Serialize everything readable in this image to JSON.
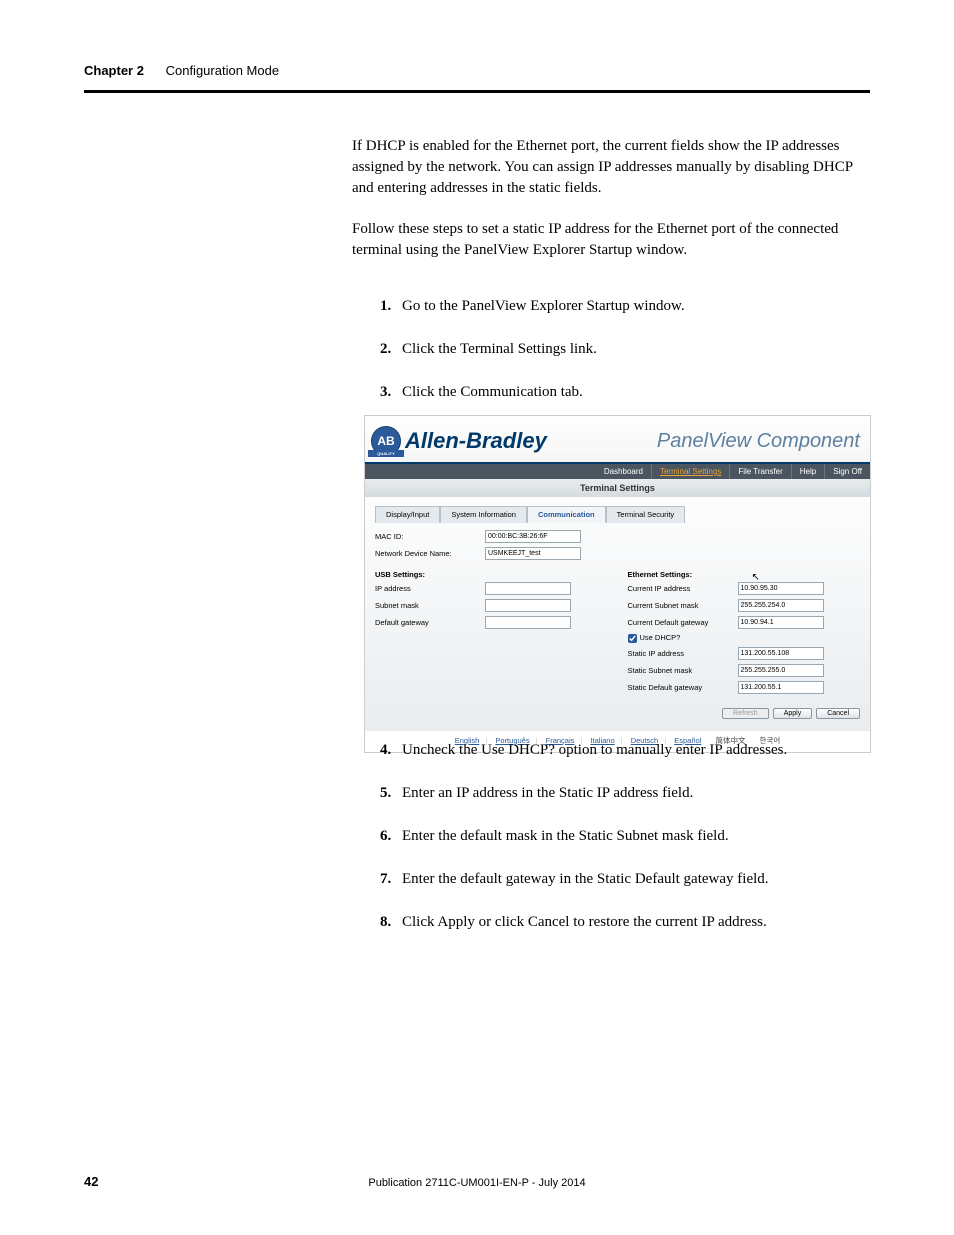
{
  "header": {
    "chapter": "Chapter 2",
    "title": "Configuration Mode"
  },
  "para1": "If DHCP is enabled for the Ethernet port, the current fields show the IP addresses assigned by the network. You can assign IP addresses manually by disabling DHCP and entering addresses in the static fields.",
  "para2": "Follow these steps to set a static IP address for the Ethernet port of the connected terminal using the PanelView Explorer Startup window.",
  "steps_a": [
    "Go to the PanelView Explorer Startup window.",
    "Click the Terminal Settings link.",
    "Click the Communication tab."
  ],
  "steps_b": [
    "Uncheck the Use DHCP? option to manually enter IP addresses.",
    "Enter an IP address in the Static IP address field.",
    "Enter the default mask in the Static Subnet mask field.",
    "Enter the default gateway in the Static Default gateway field.",
    "Click Apply or click Cancel to restore the current IP address."
  ],
  "ui": {
    "brand": "Allen-Bradley",
    "logo_text": "AB",
    "product": "PanelView Component",
    "top_tabs": [
      "Dashboard",
      "Terminal Settings",
      "File Transfer",
      "Help",
      "Sign Off"
    ],
    "section_title": "Terminal Settings",
    "sub_tabs": [
      "Display/Input",
      "System Information",
      "Communication",
      "Terminal Security"
    ],
    "mac_label": "MAC ID:",
    "mac_value": "00:00:BC:3B:26:6F",
    "dev_label": "Network Device Name:",
    "dev_value": "USMKEEJT_test",
    "usb_head": "USB Settings:",
    "usb_ip_label": "IP address",
    "usb_ip_value": "",
    "usb_mask_label": "Subnet mask",
    "usb_mask_value": "",
    "usb_gw_label": "Default gateway",
    "usb_gw_value": "",
    "eth_head": "Ethernet Settings:",
    "cur_ip_label": "Current IP address",
    "cur_ip_value": "10.90.95.30",
    "cur_mask_label": "Current Subnet mask",
    "cur_mask_value": "255.255.254.0",
    "cur_gw_label": "Current Default gateway",
    "cur_gw_value": "10.90.94.1",
    "dhcp_label": "Use DHCP?",
    "static_ip_label": "Static IP address",
    "static_ip_value": "131.200.55.108",
    "static_mask_label": "Static Subnet mask",
    "static_mask_value": "255.255.255.0",
    "static_gw_label": "Static Default gateway",
    "static_gw_value": "131.200.55.1",
    "btn_refresh": "Refresh",
    "btn_apply": "Apply",
    "btn_cancel": "Cancel",
    "langs": [
      "English",
      "Português",
      "Français",
      "Italiano",
      "Deutsch",
      "Español"
    ],
    "langs_asian": [
      "简体中文",
      "한국어"
    ]
  },
  "footer": {
    "page": "42",
    "pub": "Publication 2711C-UM001I-EN-P - July 2014"
  }
}
